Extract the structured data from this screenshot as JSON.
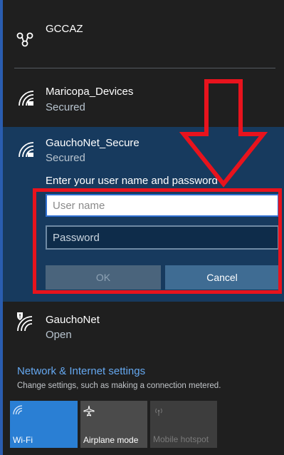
{
  "networks": [
    {
      "name": "GCCAZ",
      "status": ""
    },
    {
      "name": "Maricopa_Devices",
      "status": "Secured"
    },
    {
      "name": "GauchoNet_Secure",
      "status": "Secured"
    },
    {
      "name": "GauchoNet",
      "status": "Open"
    }
  ],
  "login": {
    "prompt": "Enter your user name and password",
    "username_placeholder": "User name",
    "password_placeholder": "Password",
    "ok_label": "OK",
    "cancel_label": "Cancel"
  },
  "settings": {
    "title": "Network & Internet settings",
    "subtitle": "Change settings, such as making a connection metered."
  },
  "quick_actions": [
    {
      "label": "Wi-Fi",
      "icon": "wifi-icon",
      "active": true
    },
    {
      "label": "Airplane mode",
      "icon": "airplane-icon",
      "active": false
    },
    {
      "label": "Mobile hotspot",
      "icon": "hotspot-icon",
      "active": false
    }
  ],
  "colors": {
    "accent": "#2a7fd4",
    "selected_bg": "#173a5e",
    "annotation": "#e8131d",
    "link": "#65a8f0"
  }
}
